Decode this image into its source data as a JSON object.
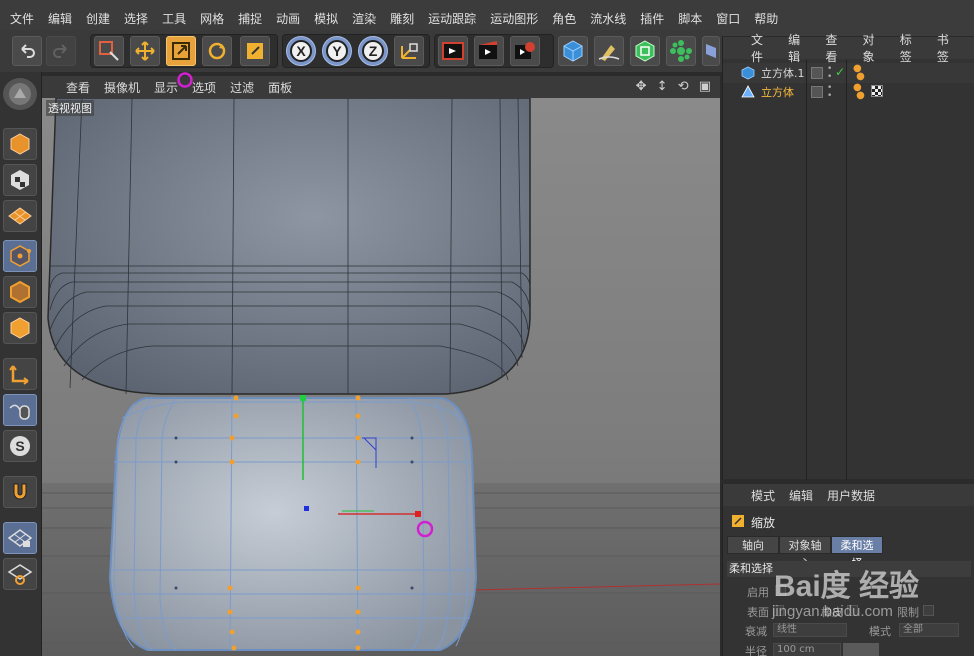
{
  "menu": [
    "文件",
    "编辑",
    "创建",
    "选择",
    "工具",
    "网格",
    "捕捉",
    "动画",
    "模拟",
    "渲染",
    "雕刻",
    "运动跟踪",
    "运动图形",
    "角色",
    "流水线",
    "插件",
    "脚本",
    "窗口",
    "帮助"
  ],
  "viewport_menu": [
    "查看",
    "摄像机",
    "显示",
    "选项",
    "过滤",
    "面板"
  ],
  "viewport_label": "透视视图",
  "object_manager": {
    "menu": [
      "文件",
      "编辑",
      "查看",
      "对象",
      "标签",
      "书签"
    ],
    "objects": [
      {
        "name": "立方体.1",
        "color": "#d8d8d8"
      },
      {
        "name": "立方体",
        "color": "#f5b93c"
      }
    ]
  },
  "attribute_manager": {
    "menu": [
      "模式",
      "编辑",
      "用户数据"
    ],
    "tool_name": "缩放",
    "tabs": [
      "轴向",
      "对象轴心",
      "柔和选择"
    ],
    "active_tab": "柔和选择",
    "section": "柔和选择",
    "fields": {
      "enable_label": "启用",
      "surface_label": "表面",
      "rubber_label": "橡皮",
      "limit_label": "限制",
      "mode_label": "模式",
      "mode_value": "全部",
      "falloff_label": "衰减",
      "falloff_value": "线性",
      "radius_label": "半径",
      "radius_value": "100 cm"
    }
  },
  "watermark": {
    "logo": "Bai度 经验",
    "url": "jingyan.baidu.com"
  },
  "colors": {
    "accent": "#e8a23c",
    "selected_blue": "#6a7fa6"
  }
}
